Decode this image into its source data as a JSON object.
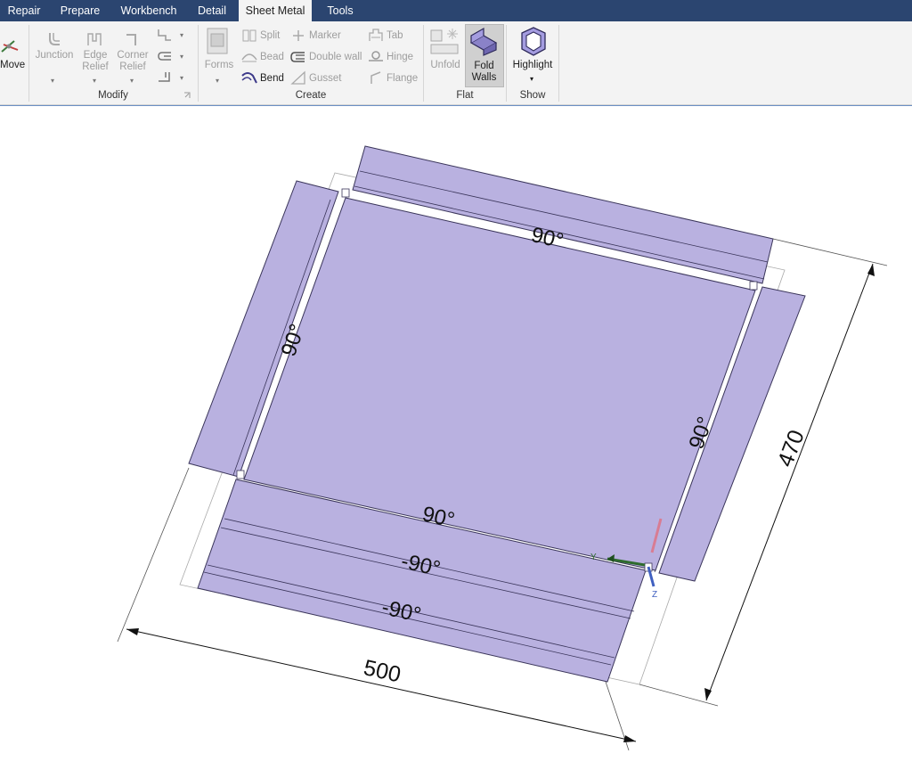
{
  "tabs": [
    {
      "label": "Repair"
    },
    {
      "label": "Prepare"
    },
    {
      "label": "Workbench"
    },
    {
      "label": "Detail"
    },
    {
      "label": "Sheet Metal",
      "active": true
    },
    {
      "label": "Tools"
    }
  ],
  "ribbon": {
    "move_label": "Move",
    "modify": {
      "junction": "Junction",
      "edge_relief_1": "Edge",
      "edge_relief_2": "Relief",
      "corner_relief_1": "Corner",
      "corner_relief_2": "Relief",
      "group_label": "Modify"
    },
    "create": {
      "forms": "Forms",
      "split": "Split",
      "marker": "Marker",
      "tab": "Tab",
      "bead": "Bead",
      "double_wall": "Double wall",
      "hinge": "Hinge",
      "bend": "Bend",
      "gusset": "Gusset",
      "flange": "Flange",
      "group_label": "Create"
    },
    "flat": {
      "unfold": "Unfold",
      "fold_walls_1": "Fold",
      "fold_walls_2": "Walls",
      "group_label": "Flat"
    },
    "show": {
      "highlight": "Highlight",
      "group_label": "Show"
    }
  },
  "model": {
    "bend_labels": [
      "90°",
      "90°",
      "90°",
      "90°",
      "-90°",
      "-90°"
    ],
    "dim_width": "500",
    "dim_height": "470",
    "axis_y": "Y",
    "axis_z": "Z",
    "colors": {
      "sheet": "#b9b1e0",
      "edge": "#3a355a",
      "tab_bar": "#2b4570",
      "ribbon": "#f3f3f3"
    }
  }
}
